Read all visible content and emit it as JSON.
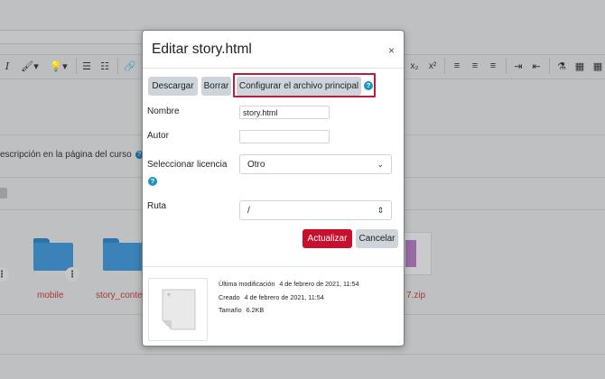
{
  "background": {
    "toolbar_glyphs": [
      "I",
      "🖌▾",
      "💡▾",
      "☰",
      "☷",
      "🔗",
      "x₂",
      "x²",
      "≡",
      "≡",
      "≡",
      "⇥",
      "⇤",
      "⚗",
      "▦",
      "▦"
    ],
    "course_description_label": "escripción en la página del curso",
    "folders": [
      {
        "label": "mobile"
      },
      {
        "label": "story_conter"
      }
    ],
    "zip_label": "7.zip"
  },
  "dialog": {
    "title": "Editar story.html",
    "close_glyph": "×",
    "buttons": {
      "download": "Descargar",
      "delete": "Borrar",
      "set_main": "Configurar el archivo principal",
      "help": "?"
    },
    "form": {
      "name_label": "Nombre",
      "name_value": "story.html",
      "author_label": "Autor",
      "author_value": "",
      "license_label": "Seleccionar licencia",
      "license_value": "Otro",
      "license_help": "?",
      "path_label": "Ruta",
      "path_value": "/"
    },
    "actions": {
      "update": "Actualizar",
      "cancel": "Cancelar"
    },
    "file_info": {
      "modified_label": "Última modificación",
      "modified_value": "4 de febrero de 2021, 11:54",
      "created_label": "Creado",
      "created_value": "4 de febrero de 2021, 11:54",
      "size_label": "Tamaño",
      "size_value": "6.2KB"
    }
  },
  "colors": {
    "primary": "#c8102e",
    "highlight_border": "#b91d3a",
    "help_icon": "#1e94c1",
    "secondary_button": "#ced4da"
  }
}
